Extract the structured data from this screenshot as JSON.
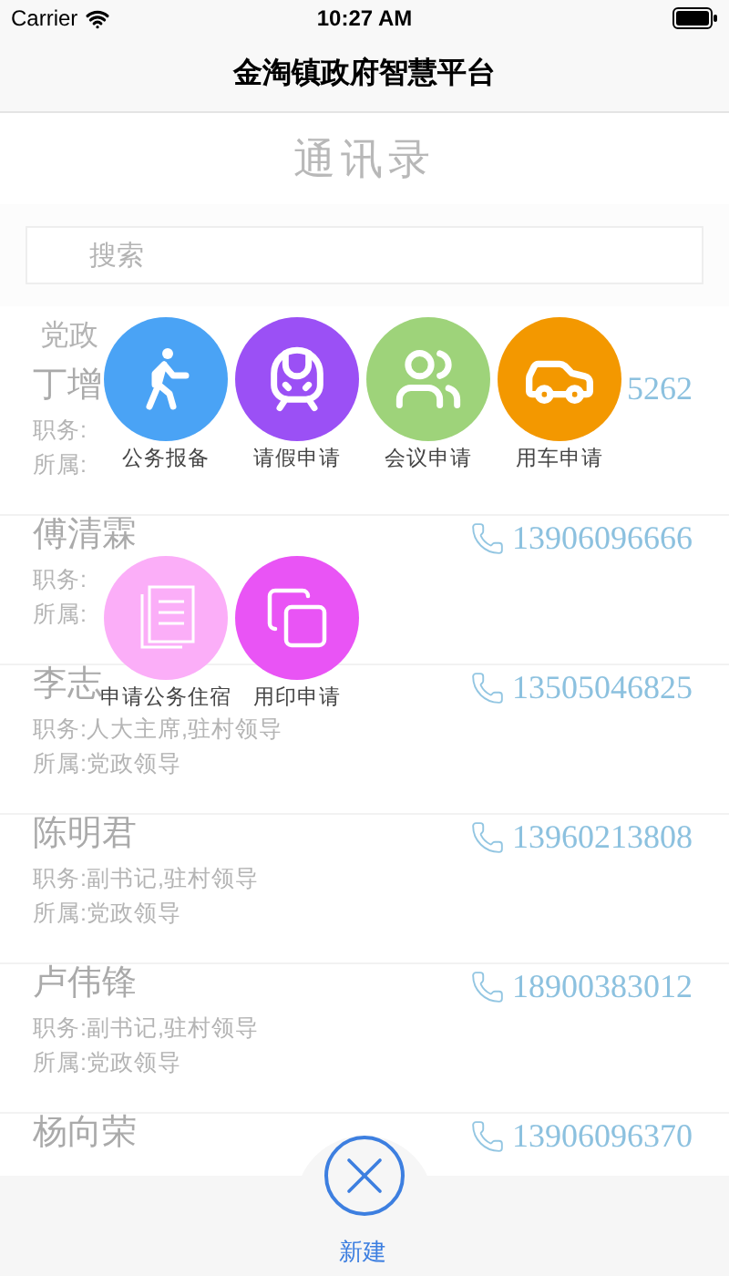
{
  "status_bar": {
    "carrier": "Carrier",
    "time": "10:27 AM"
  },
  "nav_title": "金淘镇政府智慧平台",
  "contacts": {
    "title": "通讯录",
    "search": {
      "placeholder": "搜索"
    },
    "section": "党政",
    "rows": [
      {
        "name": "丁增",
        "duty": "职务:",
        "dept": "所属:",
        "phone": "5262",
        "phone_icon": false
      },
      {
        "name": "傅清霖",
        "duty": "职务:",
        "dept": "所属:",
        "phone": "13906096666",
        "phone_icon": true
      },
      {
        "name": "李志",
        "duty": "职务:人大主席,驻村领导",
        "dept": "所属:党政领导",
        "phone": "13505046825",
        "phone_icon": true
      },
      {
        "name": "陈明君",
        "duty": "职务:副书记,驻村领导",
        "dept": "所属:党政领导",
        "phone": "13960213808",
        "phone_icon": true
      },
      {
        "name": "卢伟锋",
        "duty": "职务:副书记,驻村领导",
        "dept": "所属:党政领导",
        "phone": "18900383012",
        "phone_icon": true
      },
      {
        "name": "杨向荣",
        "phone": "13906096370",
        "phone_icon": true
      }
    ]
  },
  "menu": [
    {
      "label": "公务报备",
      "kind": "walk",
      "color": "#4aa3f5"
    },
    {
      "label": "请假申请",
      "kind": "train",
      "color": "#9b50f5"
    },
    {
      "label": "会议申请",
      "kind": "meeting",
      "color": "#9ed37a"
    },
    {
      "label": "用车申请",
      "kind": "car",
      "color": "#f39800"
    },
    {
      "label": "申请公务住宿",
      "kind": "lodging",
      "color": "#fbaef8"
    },
    {
      "label": "用印申请",
      "kind": "seal",
      "color": "#e954f5"
    }
  ],
  "tab_bar": {
    "label": "新建"
  }
}
